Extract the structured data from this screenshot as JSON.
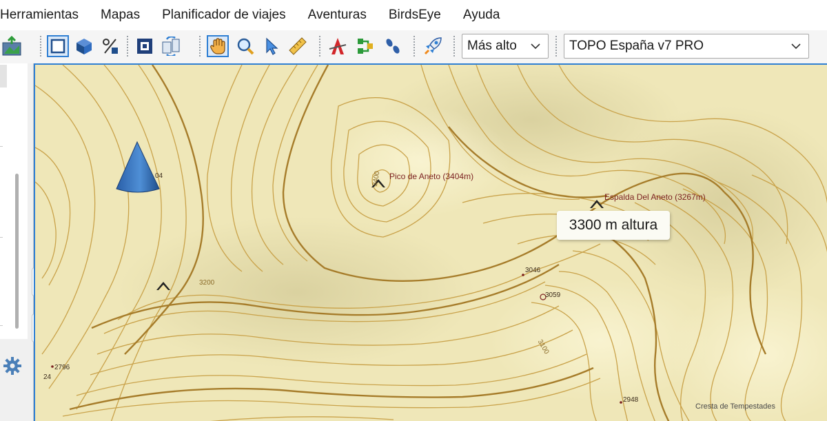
{
  "menu": {
    "items": [
      "Herramientas",
      "Mapas",
      "Planificador de viajes",
      "Aventuras",
      "BirdsEye",
      "Ayuda"
    ]
  },
  "toolbar": {
    "detail_combo": {
      "value": "Más alto"
    },
    "map_combo": {
      "value": "TOPO España v7 PRO"
    },
    "icons": [
      "export-icon",
      "select-area-icon",
      "3d-view-icon",
      "percent-icon",
      "fit-icon",
      "transfer-icon",
      "hand-icon",
      "zoom-icon",
      "pointer-icon",
      "measure-icon",
      "route-icon",
      "track-icon",
      "footprints-icon",
      "rocket-icon"
    ]
  },
  "map": {
    "tooltip": "3300 m altura",
    "labels": {
      "pico_aneto": "Pico de Aneto (3404m)",
      "espalda_aneto": "Espalda Del Aneto (3267m)",
      "spot_3046": "3046",
      "spot_3059": "3059",
      "spot_2948": "2948",
      "spot_2796": "2796",
      "spot_24": "24",
      "spot_04": "04",
      "contour_3200": "3200",
      "contour_3100": "3100",
      "contour_3400": "3400",
      "credit": "Cresta de Tempestades"
    },
    "colors": {
      "background": "#efe7b8",
      "contour": "#c9a24a",
      "contour_index": "#a67c2a",
      "label": "#7a1f1f",
      "accent": "#2f7fd3"
    }
  }
}
